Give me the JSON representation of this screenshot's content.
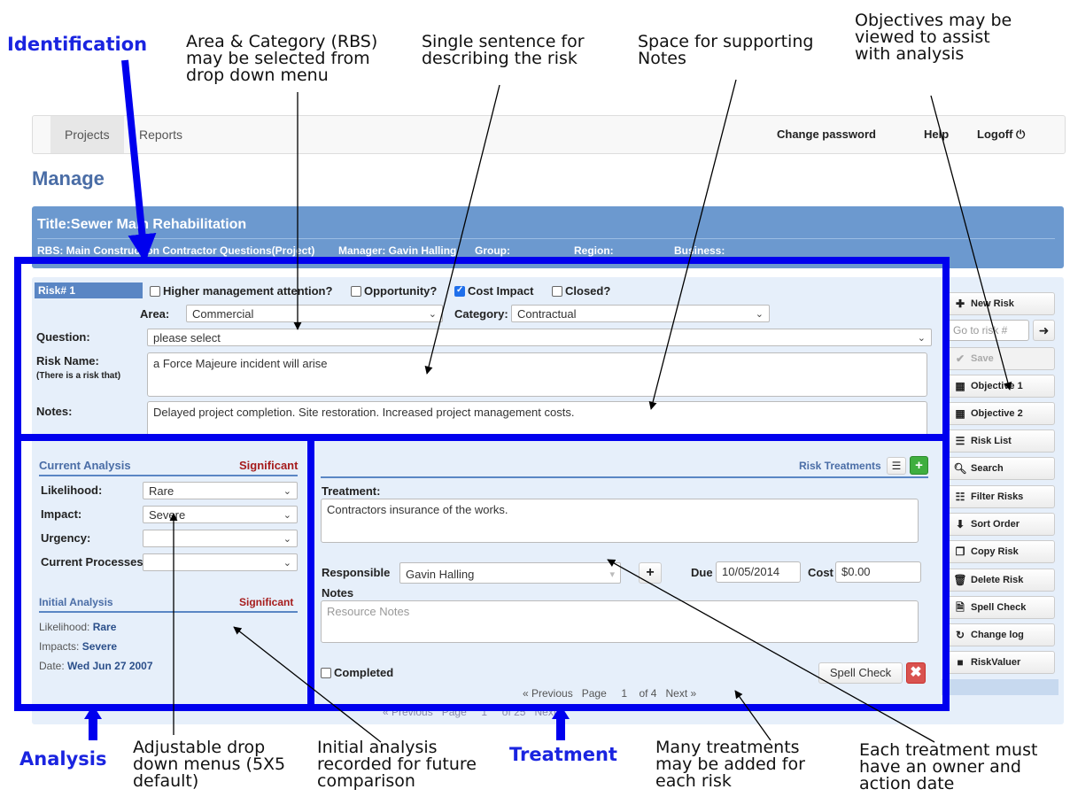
{
  "annotations": {
    "identification": "Identification",
    "area_category": "Area & Category (RBS)\nmay be selected from\ndrop down menu",
    "single_sentence": "Single sentence for\ndescribing the risk",
    "supporting_notes": "Space for supporting\nNotes",
    "objectives": "Objectives may be\nviewed to assist\nwith analysis",
    "analysis": "Analysis",
    "adjustable": "Adjustable drop\ndown menus (5X5\ndefault)",
    "initial_recorded": "Initial analysis\nrecorded for future\ncomparison",
    "treatment": "Treatment",
    "many_treatments": "Many treatments\nmay be added for\neach risk",
    "owner_date": "Each treatment must\nhave an owner and\naction date"
  },
  "nav": {
    "projects": "Projects",
    "reports": "Reports",
    "change_password": "Change password",
    "help": "Help",
    "logoff": "Logoff",
    "logoff_icon": "power-icon"
  },
  "page_title": "Manage",
  "project": {
    "title": "Title:Sewer Main Rehabilitation",
    "rbs": "RBS: Main Construction Contractor Questions(Project)",
    "manager": "Manager: Gavin Halling",
    "group": "Group:",
    "region": "Region:",
    "business": "Business:"
  },
  "risk": {
    "number": "Risk# 1",
    "higher_mgmt": "Higher management attention?",
    "opportunity": "Opportunity?",
    "cost_impact": "Cost Impact",
    "closed": "Closed?",
    "area_label": "Area:",
    "area_value": "Commercial",
    "category_label": "Category:",
    "category_value": "Contractual",
    "question_label": "Question:",
    "question_value": "please select",
    "name_label": "Risk Name:",
    "name_sub": "(There is a risk that)",
    "name_value": "a Force Majeure incident will arise",
    "notes_label": "Notes:",
    "notes_value": "Delayed project completion. Site restoration. Increased project management costs."
  },
  "current_analysis": {
    "title": "Current Analysis",
    "rating": "Significant",
    "likelihood_label": "Likelihood:",
    "likelihood_value": "Rare",
    "impact_label": "Impact:",
    "impact_value": "Severe",
    "urgency_label": "Urgency:",
    "urgency_value": "",
    "processes_label": "Current Processes:",
    "processes_value": ""
  },
  "initial_analysis": {
    "title": "Initial Analysis",
    "rating": "Significant",
    "likelihood_label": "Likelihood:",
    "likelihood_value": "Rare",
    "impacts_label": "Impacts:",
    "impacts_value": "Severe",
    "date_label": "Date:",
    "date_value": "Wed Jun 27 2007"
  },
  "treatment": {
    "header": "Risk Treatments",
    "treatment_label": "Treatment:",
    "treatment_value": "Contractors insurance of the works.",
    "responsible_label": "Responsible",
    "responsible_value": "Gavin Halling",
    "due_label": "Due",
    "due_value": "10/05/2014",
    "cost_label": "Cost",
    "cost_value": "$0.00",
    "notes_label": "Notes",
    "notes_placeholder": "Resource Notes",
    "completed_label": "Completed",
    "spell_check": "Spell Check",
    "pager_prev": "«  Previous",
    "pager_page": "Page",
    "pager_num": "1",
    "pager_of": "of 4",
    "pager_next": "Next  »"
  },
  "outer_pager": {
    "prev": "«  Previous",
    "page": "Page",
    "num": "1",
    "of": "of 25",
    "next": "Next  »"
  },
  "sidebar": {
    "new_risk": "New Risk",
    "goto_placeholder": "Go to risk #",
    "save": "Save",
    "objective1": "Objective 1",
    "objective2": "Objective 2",
    "risk_list": "Risk List",
    "search": "Search",
    "filter": "Filter Risks",
    "sort": "Sort Order",
    "copy": "Copy Risk",
    "delete": "Delete Risk",
    "spell": "Spell Check",
    "changelog": "Change log",
    "riskvaluer": "RiskValuer"
  }
}
